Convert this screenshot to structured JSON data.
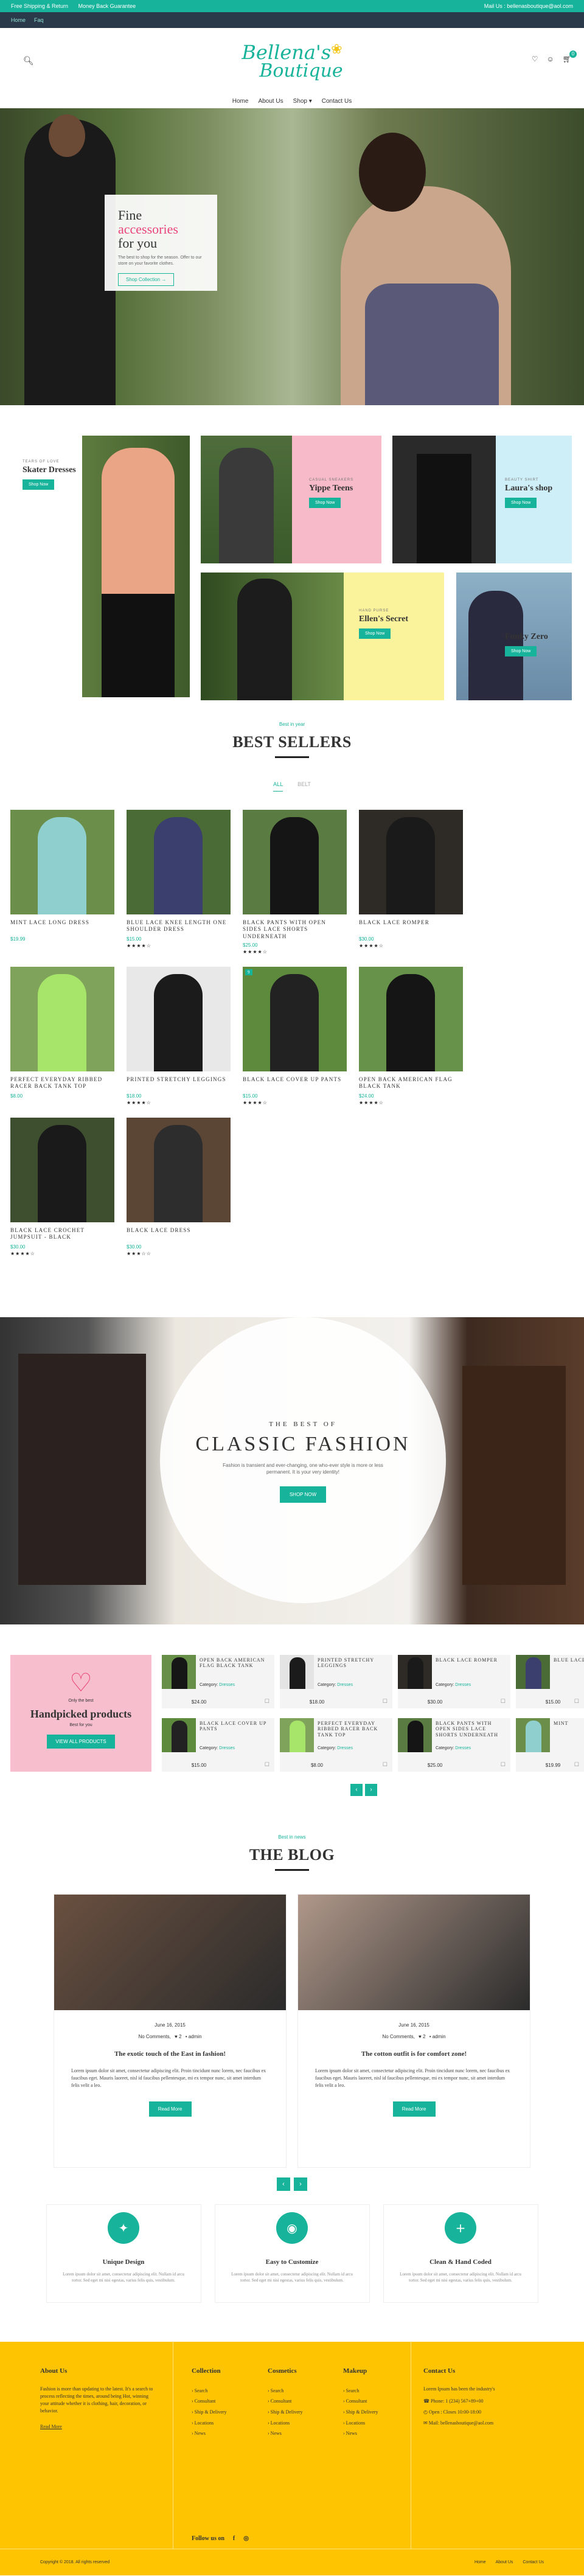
{
  "topbar": {
    "shipping": "Free Shipping & Return",
    "guarantee": "Money Back Guarantee",
    "email": "Mail Us : bellenasboutique@aol.com"
  },
  "subbar": {
    "lang": "Home",
    "currency": "Faq"
  },
  "logo": {
    "line1": "Bellena's",
    "line2": "Boutique"
  },
  "cart": {
    "count": "0"
  },
  "nav": [
    "Home",
    "About Us",
    "Shop ▾",
    "Contact Us"
  ],
  "hero": {
    "title_a": "Fine ",
    "title_b": "accessories",
    "title_c": "for you",
    "desc": "The best to shop for the season. Offer to our store on your favorite clothes.",
    "button": "Shop Collection →"
  },
  "categories": [
    {
      "tag": "TEARS OF LOVE",
      "title": "Skater Dresses",
      "button": "Shop Now"
    },
    {
      "tag": "CASUAL SNEAKERS",
      "title": "Yippe Teens",
      "button": "Shop Now"
    },
    {
      "tag": "BEAUTY SHIRT",
      "title": "Laura's shop",
      "button": "Shop Now"
    },
    {
      "tag": "HAND PURSE",
      "title": "Ellen's Secret",
      "button": "Shop Now"
    },
    {
      "tag": "",
      "title": "Funky Zero",
      "button": "Shop Now"
    }
  ],
  "bestsellers": {
    "pre": "Best in year",
    "title": "BEST SELLERS",
    "tabs": [
      "ALL",
      "BELT"
    ],
    "products": [
      {
        "name": "MINT LACE LONG DRESS",
        "price": "$19.99",
        "stars": "",
        "color": "#6b8f4a",
        "body": "#8fd0cf",
        "tag": ""
      },
      {
        "name": "BLUE LACE KNEE LENGTH ONE SHOULDER DRESS",
        "price": "$15.00",
        "stars": "★★★★☆",
        "color": "#4a6b35",
        "body": "#3b3f6e",
        "tag": ""
      },
      {
        "name": "BLACK PANTS WITH OPEN SIDES LACE SHORTS UNDERNEATH",
        "price": "$25.00",
        "stars": "★★★★☆",
        "color": "#5a7b42",
        "body": "#151515",
        "tag": ""
      },
      {
        "name": "BLACK LACE ROMPER",
        "price": "$30.00",
        "stars": "★★★★☆",
        "color": "#2e2a26",
        "body": "#1a1a1a",
        "tag": ""
      },
      {
        "name": "PERFECT EVERYDAY RIBBED RACER BACK TANK TOP",
        "price": "$8.00",
        "stars": "",
        "color": "#7fa35a",
        "body": "#a7e46a",
        "tag": ""
      },
      {
        "name": "PRINTED STRETCHY LEGGINGS",
        "price": "$18.00",
        "stars": "★★★★☆",
        "color": "#e8e8e8",
        "body": "#1b1b1b",
        "tag": ""
      },
      {
        "name": "BLACK LACE COVER UP PANTS",
        "price": "$15.00",
        "stars": "★★★★☆",
        "color": "#5d8a3d",
        "body": "#222",
        "tag": "9"
      },
      {
        "name": "OPEN BACK AMERICAN FLAG BLACK TANK",
        "price": "$24.00",
        "stars": "★★★★☆",
        "color": "#66924a",
        "body": "#151515",
        "tag": ""
      },
      {
        "name": "BLACK LACE CROCHET JUMPSUIT - BLACK",
        "price": "$30.00",
        "stars": "★★★★☆",
        "color": "#3e4f30",
        "body": "#1a1a1a",
        "tag": ""
      },
      {
        "name": "BLACK LACE DRESS",
        "price": "$30.00",
        "stars": "★★★☆☆",
        "color": "#5b4636",
        "body": "#2d2d2d",
        "tag": ""
      }
    ]
  },
  "classic": {
    "kicker": "THE BEST OF",
    "title": "CLASSIC FASHION",
    "desc": "Fashion is transient and ever-changing, one who-ever style is more or less permanent. It is your very identity!",
    "button": "SHOP NOW"
  },
  "handpicked": {
    "sub1": "Only the best",
    "title": "Handpicked products",
    "sub2": "Best for you",
    "button": "VIEW ALL PRODUCTS",
    "items": [
      {
        "name": "OPEN BACK AMERICAN FLAG BLACK TANK",
        "category": "Dresses",
        "price": "$24.00",
        "color": "#678f48",
        "body": "#161616"
      },
      {
        "name": "PRINTED STRETCHY LEGGINGS",
        "category": "Dresses",
        "price": "$18.00",
        "color": "#e4e4e4",
        "body": "#1b1b1b"
      },
      {
        "name": "BLACK LACE ROMPER",
        "category": "Dresses",
        "price": "$30.00",
        "color": "#2e2a26",
        "body": "#1a1a1a"
      },
      {
        "name": "BLUE LACE",
        "category": "",
        "price": "$15.00",
        "color": "#4a6b35",
        "body": "#3b3f6e"
      },
      {
        "name": "BLACK LACE COVER UP PANTS",
        "category": "Dresses",
        "price": "$15.00",
        "color": "#5d8a3d",
        "body": "#222"
      },
      {
        "name": "PERFECT EVERYDAY RIBBED RACER BACK TANK TOP",
        "category": "Dresses",
        "price": "$8.00",
        "color": "#7fa35a",
        "body": "#a7e46a"
      },
      {
        "name": "BLACK PANTS WITH OPEN SIDES LACE SHORTS UNDERNEATH",
        "category": "Dresses",
        "price": "$25.00",
        "color": "#5a7b42",
        "body": "#151515"
      },
      {
        "name": "MINT",
        "category": "",
        "price": "$19.99",
        "color": "#6b8f4a",
        "body": "#8fd0cf"
      }
    ]
  },
  "blog": {
    "pre": "Best in news",
    "title": "THE BLOG",
    "posts": [
      {
        "date": "June 16, 2015",
        "meta": "No Comments,  ♥ 2  • admin",
        "title": "The exotic touch of the East in fashion!",
        "text": "Lorem ipsum dolor sit amet, consectetur adipiscing elit. Proin tincidunt nunc lorem, nec faucibus ex faucibus eget. Mauris laoreet, nisl id faucibus pellentesque, mi ex tempor nunc, sit amet interdum felis velit a leo.",
        "button": "Read More",
        "img": "#6a5040"
      },
      {
        "date": "June 16, 2015",
        "meta": "No Comments,  ♥ 2  • admin",
        "title": "The cotton outfit is for comfort zone!",
        "text": "Lorem ipsum dolor sit amet, consectetur adipiscing elit. Proin tincidunt nunc lorem, nec faucibus ex faucibus eget. Mauris laoreet, nisl id faucibus pellentesque, mi ex tempor nunc, sit amet interdum felis velit a leo.",
        "button": "Read More",
        "img": "#b0988a"
      }
    ]
  },
  "features": [
    {
      "icon": "✦",
      "title": "Unique Design",
      "text": "Lorem ipsum dolor sit amet, consectetur adipiscing elit. Nullam id arcu tortor. Sed eget mi nisi egestas, varius felis quis, vestibulum."
    },
    {
      "icon": "◉",
      "title": "Easy to Customize",
      "text": "Lorem ipsum dolor sit amet, consectetur adipiscing elit. Nullam id arcu tortor. Sed eget mi nisi egestas, varius felis quis, vestibulum."
    },
    {
      "icon": "+",
      "title": "Clean & Hand Coded",
      "text": "Lorem ipsum dolor sit amet, consectetur adipiscing elit. Nullam id arcu tortor. Sed eget mi nisi egestas, varius felis quis, vestibulum."
    }
  ],
  "footer": {
    "about_title": "About Us",
    "about_text": "Fashion is more than updating to the latest. It's a search to process reflecting the times, around being Hot, winning your attitude whether it is clothing, hair, decoration, or behavior.",
    "about_link": "Read More",
    "collection_title": "Collection",
    "cosmetics_title": "Cosmetics",
    "makeup_title": "Makeup",
    "links": [
      "Search",
      "Consultant",
      "Ship & Delivery",
      "Locations",
      "News"
    ],
    "contact_title": "Contact Us",
    "contact_text": "Lorem Ipsum has been the industry's",
    "phone": "Phone: 1 (234) 567+89+00",
    "hours": "Open : Closes 10:00-18:00",
    "email": "Mail: bellenasboutique@aol.com",
    "follow": "Follow us on",
    "copyright": "Copyright © 2018. All rights reserved",
    "bottom_links": [
      "Home",
      "About Us",
      "Contact Us"
    ]
  }
}
